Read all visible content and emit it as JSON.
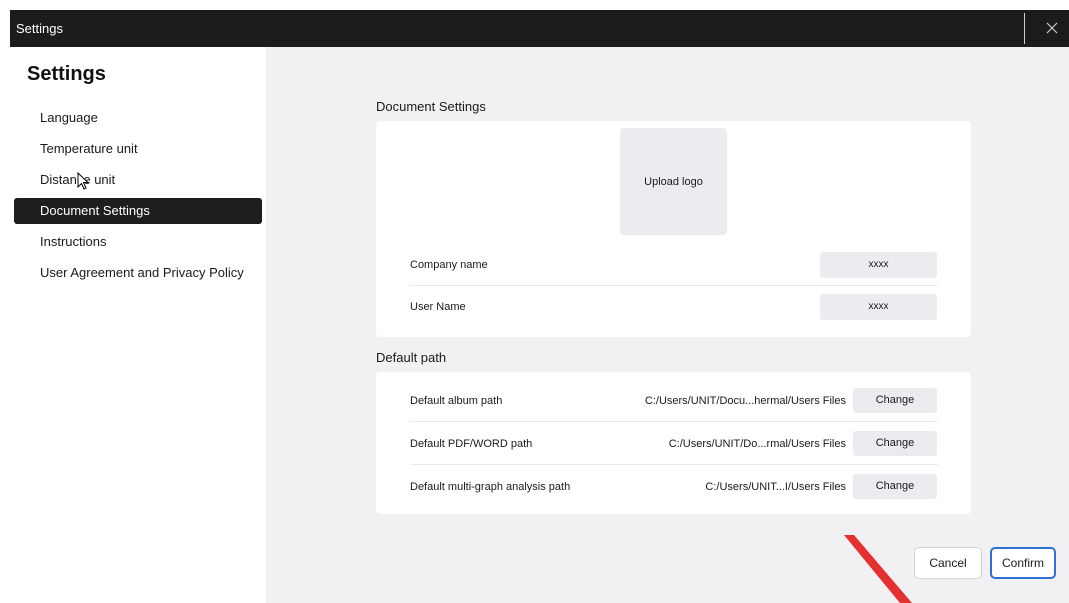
{
  "window": {
    "title": "Settings"
  },
  "sidebar": {
    "heading": "Settings",
    "items": [
      {
        "label": "Language",
        "active": false
      },
      {
        "label": "Temperature unit",
        "active": false
      },
      {
        "label": "Distance unit",
        "active": false
      },
      {
        "label": "Document Settings",
        "active": true
      },
      {
        "label": "Instructions",
        "active": false
      },
      {
        "label": "User Agreement and Privacy Policy",
        "active": false
      }
    ]
  },
  "document_settings": {
    "title": "Document Settings",
    "upload_logo_label": "Upload logo",
    "fields": [
      {
        "label": "Company name",
        "value": "xxxx"
      },
      {
        "label": "User Name",
        "value": "xxxx"
      }
    ]
  },
  "default_path": {
    "title": "Default path",
    "change_label": "Change",
    "rows": [
      {
        "label": "Default album path",
        "path": "C:/Users/UNIT/Docu...hermal/Users Files"
      },
      {
        "label": "Default PDF/WORD path",
        "path": "C:/Users/UNIT/Do...rmal/Users Files"
      },
      {
        "label": "Default multi-graph analysis path",
        "path": "C:/Users/UNIT...I/Users Files"
      }
    ]
  },
  "footer": {
    "cancel_label": "Cancel",
    "confirm_label": "Confirm"
  },
  "colors": {
    "titlebar": "#1c1c1c",
    "active_nav": "#1e1e1e",
    "confirm_border": "#2c6fd6",
    "main_bg": "#f1f1f4",
    "watermark": "#e53030"
  },
  "icons": {
    "close": "close-icon",
    "cursor": "mouse-pointer-icon",
    "watermark": "diagonal-watermark-stroke"
  }
}
